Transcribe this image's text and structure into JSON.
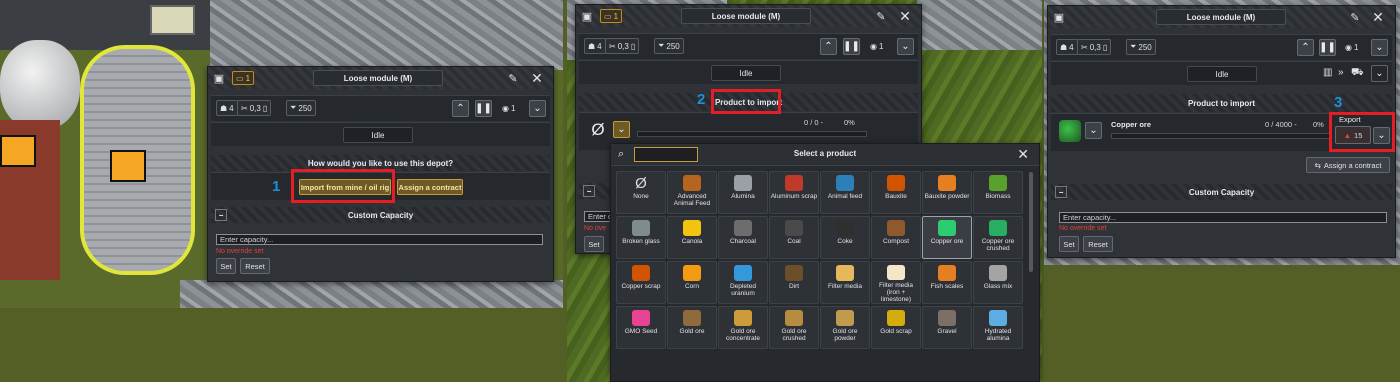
{
  "colors": {
    "accent_gold": "#c69b3a",
    "highlight_red": "#e41e24",
    "step_blue": "#1d8fd8",
    "warning_red": "#e0443b"
  },
  "steps": [
    "1",
    "2",
    "3"
  ],
  "panel1": {
    "tag_count": "1",
    "title": "Loose module (M)",
    "stats": {
      "workers": "4",
      "maintenance": "0,3",
      "units": "250",
      "priority": "1"
    },
    "status": "Idle",
    "question": "How would you like to use this depot?",
    "import_button": "Import from mine / oil rig",
    "contract_button": "Assign a contract",
    "capacity_title": "Custom Capacity",
    "capacity_placeholder": "Enter capacity...",
    "no_override": "No override set",
    "set_button": "Set",
    "reset_button": "Reset"
  },
  "panel2": {
    "tag_count": "1",
    "title": "Loose module (M)",
    "stats": {
      "workers": "4",
      "maintenance": "0,3",
      "units": "250",
      "priority": "1"
    },
    "status": "Idle",
    "product_to_import": "Product to import",
    "empty_symbol": "Ø",
    "progress_text": "0 / 0 -",
    "percent": "0%",
    "capacity_placeholder_partial": "Enter c",
    "no_override_partial": "No ove",
    "set_button": "Set"
  },
  "selector": {
    "title": "Select a product",
    "search_value": "",
    "products": [
      "None",
      "Advanced Animal Feed",
      "Alumina",
      "Aluminum scrap",
      "Animal feed",
      "Bauxite",
      "Bauxite powder",
      "Biomass",
      "Broken glass",
      "Canola",
      "Charcoal",
      "Coal",
      "Coke",
      "Compost",
      "Copper ore",
      "Copper ore crushed",
      "Copper scrap",
      "Corn",
      "Depleted uranium",
      "Dirt",
      "Filter media",
      "Filter media (iron + limestone)",
      "Fish scales",
      "Glass mix",
      "GMO Seed",
      "Gold ore",
      "Gold ore concentrate",
      "Gold ore crushed",
      "Gold ore powder",
      "Gold scrap",
      "Gravel",
      "Hydrated alumina"
    ],
    "selected": "Copper ore"
  },
  "panel3": {
    "title": "Loose module (M)",
    "stats": {
      "workers": "4",
      "maintenance": "0,3",
      "units": "250",
      "priority": "1"
    },
    "status": "Idle",
    "product_to_import": "Product to import",
    "product_name": "Copper ore",
    "progress_text": "0 / 4000 -",
    "percent": "0%",
    "export_label": "Export",
    "export_value": "15",
    "contract_button": "Assign a contract",
    "capacity_title": "Custom Capacity",
    "capacity_placeholder": "Enter capacity...",
    "no_override": "No override set",
    "set_button": "Set",
    "reset_button": "Reset"
  }
}
